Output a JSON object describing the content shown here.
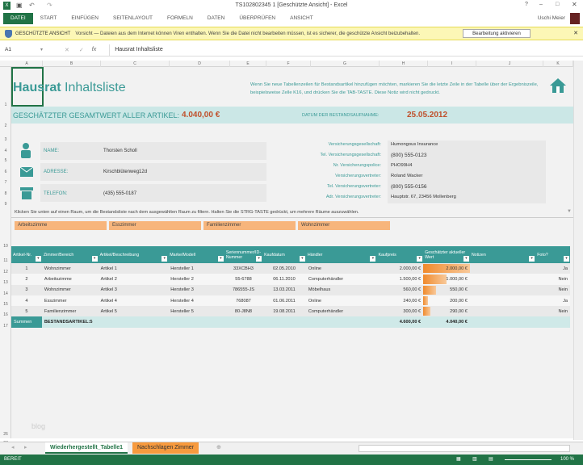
{
  "window": {
    "title": "TS102802345 1 [Geschützte Ansicht] - Excel",
    "user": "Uschi Meier"
  },
  "ribbon": {
    "tabs": [
      "DATEI",
      "START",
      "EINFÜGEN",
      "SEITENLAYOUT",
      "FORMELN",
      "DATEN",
      "ÜBERPRÜFEN",
      "ANSICHT"
    ]
  },
  "protected": {
    "title": "GESCHÜTZTE ANSICHT",
    "message": "Vorsicht — Dateien aus dem Internet können Viren enthalten. Wenn Sie die Datei nicht bearbeiten müssen, ist es sicherer, die geschützte Ansicht beizubehalten.",
    "button": "Bearbeitung aktivieren"
  },
  "formula": {
    "cell": "A1",
    "value": "Hausrat Inhaltsliste"
  },
  "columns": [
    "A",
    "B",
    "C",
    "D",
    "E",
    "F",
    "G",
    "H",
    "I",
    "J",
    "K"
  ],
  "rows": [
    "1",
    "2",
    "3",
    "4",
    "5",
    "6",
    "7",
    "8",
    "9",
    "",
    "10",
    "11",
    "12",
    "13",
    "14",
    "15",
    "16",
    "17",
    "26",
    "27"
  ],
  "sheet": {
    "title_bold": "Hausrat",
    "title_rest": " Inhaltsliste",
    "note": "Wenn Sie neue Tabellenzeilen für Bestandsartikel hinzufügen möchten, markieren Sie die letzte Zeile in der Tabelle über der Ergebniszeile, beispielsweise Zelle K16, und drücken Sie die TAB-TASTE. Diese Notiz wird nicht gedruckt.",
    "total_label": "GESCHÄTZTER GESAMTWERT ALLER ARTIKEL:",
    "total_value": "4.040,00 €",
    "date_label": "DATUM DER BESTANDSAUFNAHME:",
    "date_value": "25.05.2012",
    "name_label": "NAME:",
    "name": "Thorsten Scholl",
    "address_label": "ADRESSE:",
    "address": "Kirschblütenweg12d",
    "phone_label": "TELEFON:",
    "phone": "(435) 555-0187",
    "insurance": [
      {
        "label": "Versicherungsgesellschaft:",
        "value": "Humongous Insurance"
      },
      {
        "label": "Tel. Versicherungsgesellschaft:",
        "value": "(800) 555-0123"
      },
      {
        "label": "Nr. Versicherungspolice:",
        "value": "PHO99H4"
      },
      {
        "label": "Versicherungsvertreter:",
        "value": "Roland Wacker"
      },
      {
        "label": "Tel. Versicherungsvertreter:",
        "value": "(800) 555-0156"
      },
      {
        "label": "Adr. Versicherungsvertreter:",
        "value": "Hauptstr. 67, 23456 Mollenberg"
      }
    ],
    "filter_hint": "Klicken Sie unten auf einen Raum, um die Bestandsliste nach dem ausgewählten Raum zu filtern. Halten Sie die STRG-TASTE gedrückt, um mehrere Räume auszuwählen.",
    "rooms": [
      "Arbeitszimme",
      "Esszimmer",
      "Familienzimmer",
      "Wohnzimmer"
    ],
    "watermark": "blog"
  },
  "table": {
    "headers": [
      "Artikel-Nr.",
      "Zimmer/Bereich",
      "Artikel/Beschreibung",
      "Marke/Modell",
      "Seriennummer/ID-Nummer",
      "Kaufdatum",
      "Händler",
      "Kaufpreis",
      "Geschätzter aktueller Wert",
      "Notizen",
      "Foto?"
    ],
    "rows": [
      [
        "1",
        "Wohnzimmer",
        "Artikel 1",
        "Hersteller 1",
        "33XCBH3",
        "02.05.2010",
        "Online",
        "2.000,00 €",
        "2.000,00 €",
        "",
        "Ja"
      ],
      [
        "2",
        "Arbeitszimme",
        "Artikel 2",
        "Hersteller 2",
        "55-6788",
        "06.11.2010",
        "Computerhändler",
        "1.500,00 €",
        "1.000,00 €",
        "",
        "Nein"
      ],
      [
        "3",
        "Wohnzimmer",
        "Artikel 3",
        "Hersteller 3",
        "786555-JS",
        "13.03.2011",
        "Möbelhaus",
        "560,00 €",
        "550,00 €",
        "",
        "Nein"
      ],
      [
        "4",
        "Esszimmer",
        "Artikel 4",
        "Hersteller 4",
        "768087",
        "01.06.2011",
        "Online",
        "240,00 €",
        "200,00 €",
        "",
        "Ja"
      ],
      [
        "5",
        "Familienzimmer",
        "Artikel 5",
        "Hersteller 5",
        "80-J8N8",
        "19.08.2011",
        "Computerhändler",
        "300,00 €",
        "290,00 €",
        "",
        "Nein"
      ]
    ],
    "value_fraction": [
      1,
      0.5,
      0.275,
      0.1,
      0.145
    ],
    "summary": {
      "label": "Summen",
      "count": "BESTANDSARTIKEL:5",
      "price": "4.600,00 €",
      "value": "4.040,00 €"
    }
  },
  "sheet_tabs": [
    "Wiederhergestellt_Tabelle1",
    "Nachschlagen Zimmer"
  ],
  "status": {
    "text": "BEREIT",
    "zoom": "100 %"
  }
}
